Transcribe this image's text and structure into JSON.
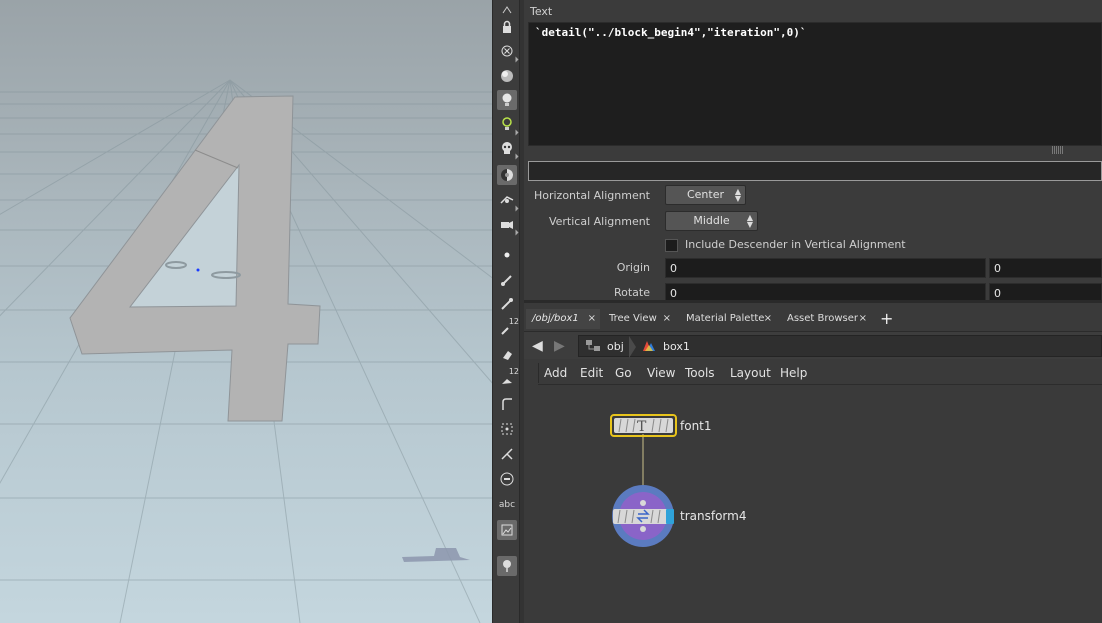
{
  "parameters": {
    "text_label": "Text",
    "text_value": "`detail(\"../block_begin4\",\"iteration\",0)`",
    "horizontal_alignment": {
      "label": "Horizontal Alignment",
      "value": "Center"
    },
    "vertical_alignment": {
      "label": "Vertical Alignment",
      "value": "Middle"
    },
    "include_descender": {
      "label": "Include Descender in Vertical Alignment",
      "checked": false
    },
    "origin": {
      "label": "Origin",
      "x": "0",
      "y": "0"
    },
    "rotate": {
      "label": "Rotate",
      "x": "0",
      "y": "0"
    }
  },
  "tabs": [
    {
      "label": "/obj/box1",
      "active": true
    },
    {
      "label": "Tree View",
      "active": false
    },
    {
      "label": "Material Palette",
      "active": false
    },
    {
      "label": "Asset Browser",
      "active": false
    }
  ],
  "tab_close_glyph": "×",
  "add_tab_glyph": "+",
  "path": {
    "level1": "obj",
    "level2": "box1"
  },
  "menu": [
    "Add",
    "Edit",
    "Go",
    "View",
    "Tools",
    "Layout",
    "Help"
  ],
  "nodes": [
    {
      "name": "font1",
      "selected": true
    },
    {
      "name": "transform4",
      "display": true
    }
  ],
  "toolbar": {
    "icons": [
      "lock-icon",
      "xray-icon",
      "ghost-icon",
      "light-icon",
      "lightbulb-icon",
      "skull-icon",
      "shading-icon",
      "camera-icon",
      "camera-persp-icon",
      "point-icon",
      "brush-icon",
      "pick-icon",
      "number-12-icon",
      "eraser-icon",
      "number-12b-icon",
      "curve-icon",
      "grid-snap-icon",
      "handle-icon",
      "menu-icon",
      "abc-icon",
      "image-icon",
      "pin-icon"
    ],
    "label_12": "12",
    "label_abc": "abc"
  },
  "colors": {
    "selected_node": "#e8c41c",
    "display_flag": "#2fa2d9",
    "node_purple": "#8a64c8",
    "node_blue_ring": "#5b7bc0"
  }
}
